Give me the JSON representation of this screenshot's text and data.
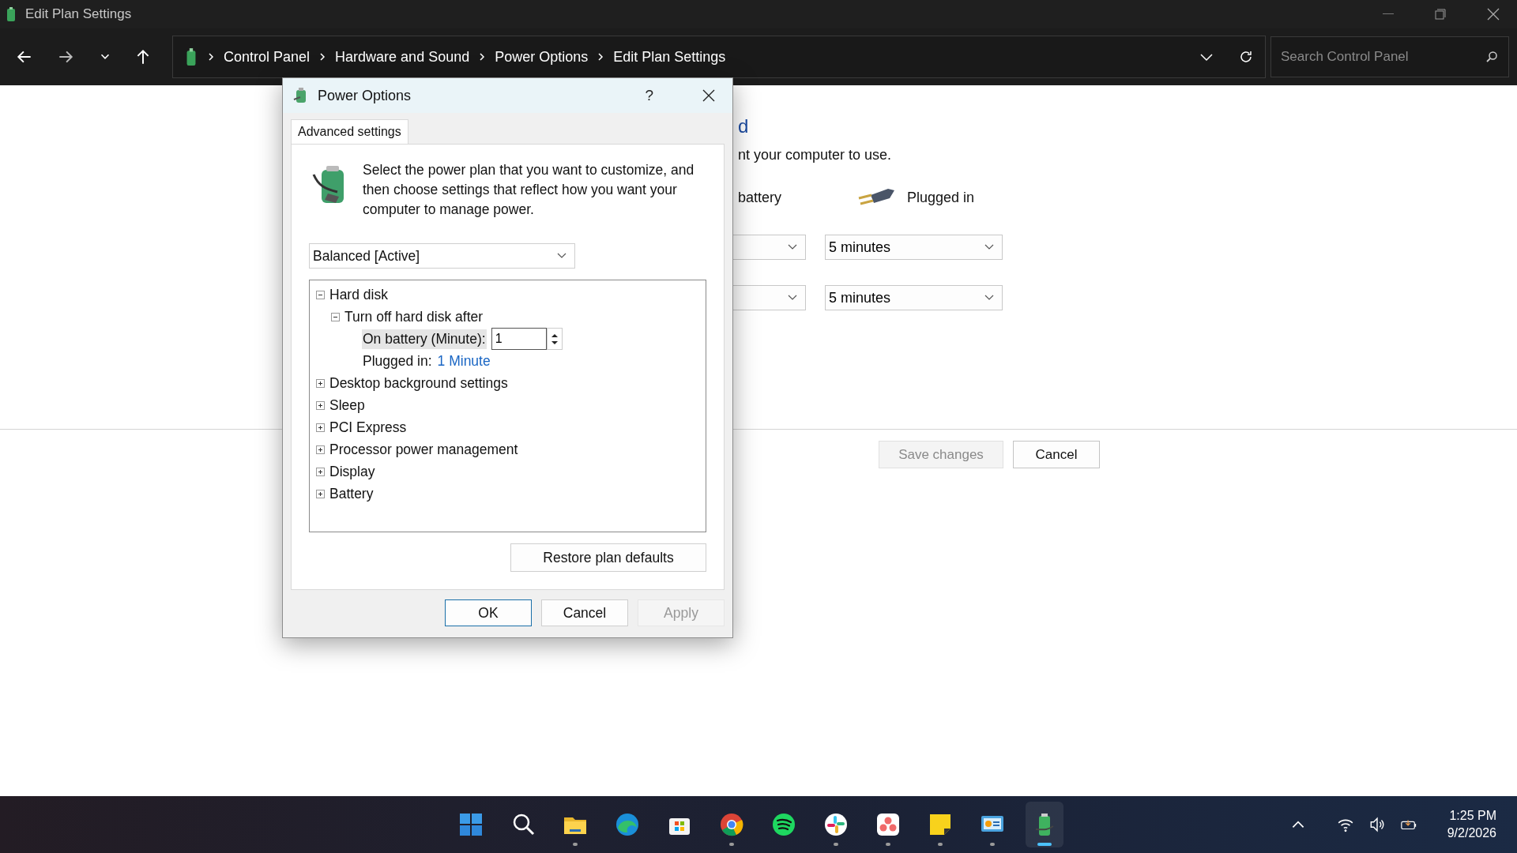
{
  "window": {
    "title": "Edit Plan Settings"
  },
  "address_bar": {
    "breadcrumbs": [
      "Control Panel",
      "Hardware and Sound",
      "Power Options",
      "Edit Plan Settings"
    ]
  },
  "search": {
    "placeholder": "Search Control Panel"
  },
  "page": {
    "heading": "d",
    "description": "nt your computer to use.",
    "columns": [
      "battery",
      "Plugged in"
    ],
    "settings": [
      {
        "plugged_in": "5 minutes"
      },
      {
        "plugged_in": "5 minutes"
      }
    ],
    "buttons": [
      {
        "label": "Save changes",
        "disabled": true
      },
      {
        "label": "Cancel",
        "disabled": false
      }
    ]
  },
  "dialog": {
    "title": "Power Options",
    "help": "?",
    "tabs": [
      {
        "label": "Advanced settings",
        "selected": true
      }
    ],
    "intro": "Select the power plan that you want to customize, and then choose settings that reflect how you want your computer to manage power.",
    "plan": "Balanced [Active]",
    "tree": [
      {
        "label": "Hard disk",
        "expanded": true,
        "children": [
          {
            "label": "Turn off hard disk after",
            "expanded": true,
            "children": [
              {
                "kind": "spin",
                "label": "On battery (Minute):",
                "value": "1",
                "selected": true
              },
              {
                "kind": "link",
                "label": "Plugged in:",
                "value": "1 Minute",
                "selected": false
              }
            ]
          }
        ]
      },
      {
        "label": "Desktop background settings",
        "expanded": false
      },
      {
        "label": "Sleep",
        "expanded": false
      },
      {
        "label": "PCI Express",
        "expanded": false
      },
      {
        "label": "Processor power management",
        "expanded": false
      },
      {
        "label": "Display",
        "expanded": false
      },
      {
        "label": "Battery",
        "expanded": false
      }
    ],
    "restore": "Restore plan defaults",
    "buttons": [
      {
        "label": "OK",
        "default": true,
        "disabled": false
      },
      {
        "label": "Cancel",
        "default": false,
        "disabled": false
      },
      {
        "label": "Apply",
        "default": false,
        "disabled": true
      }
    ]
  },
  "taskbar": {
    "apps": [
      {
        "kind": "start",
        "running": false,
        "selected": false
      },
      {
        "kind": "search",
        "running": false,
        "selected": false
      },
      {
        "kind": "folder",
        "running": true,
        "selected": false
      },
      {
        "kind": "edge",
        "running": false,
        "selected": false
      },
      {
        "kind": "store",
        "running": false,
        "selected": false
      },
      {
        "kind": "chrome",
        "running": true,
        "selected": false
      },
      {
        "kind": "spotify",
        "running": false,
        "selected": false
      },
      {
        "kind": "slack",
        "running": true,
        "selected": false
      },
      {
        "kind": "asana",
        "running": true,
        "selected": false
      },
      {
        "kind": "notes",
        "running": true,
        "selected": false
      },
      {
        "kind": "control",
        "running": true,
        "selected": false
      },
      {
        "kind": "power",
        "running": true,
        "selected": true
      }
    ],
    "clock": {
      "time": "1:25 PM",
      "date": "9/2/2026"
    }
  }
}
